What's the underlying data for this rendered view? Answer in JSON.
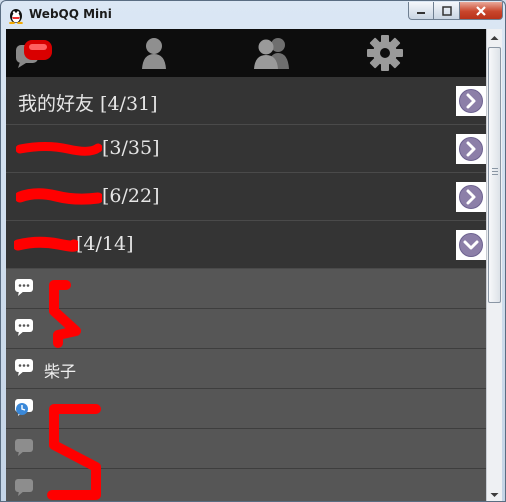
{
  "window": {
    "title": "WebQQ Mini"
  },
  "toolbar": {
    "items": [
      {
        "icon": "qq-chat-icon"
      },
      {
        "icon": "contacts-icon"
      },
      {
        "icon": "groups-icon"
      },
      {
        "icon": "gear-icon"
      }
    ]
  },
  "groups": [
    {
      "label": "我的好友  [4/31]",
      "state": "collapsed"
    },
    {
      "label": "[3/35]",
      "state": "collapsed"
    },
    {
      "label": "[6/22]",
      "state": "collapsed"
    },
    {
      "label": "[4/14]",
      "state": "expanded"
    }
  ],
  "friends": [
    {
      "name": "",
      "icon": "chat-bubble-icon"
    },
    {
      "name": "",
      "icon": "chat-bubble-icon"
    },
    {
      "name": "柴子",
      "icon": "chat-bubble-icon"
    },
    {
      "name": "",
      "icon": "away-status-icon"
    },
    {
      "name": "",
      "icon": "offline-bubble-icon"
    },
    {
      "name": "",
      "icon": "offline-bubble-icon"
    }
  ],
  "colors": {
    "toolbar": "#0d0d0d",
    "group_row": "#343434",
    "friend_row": "#565656",
    "arrow_badge": "#8c7fa8",
    "redaction": "#ff0000"
  }
}
